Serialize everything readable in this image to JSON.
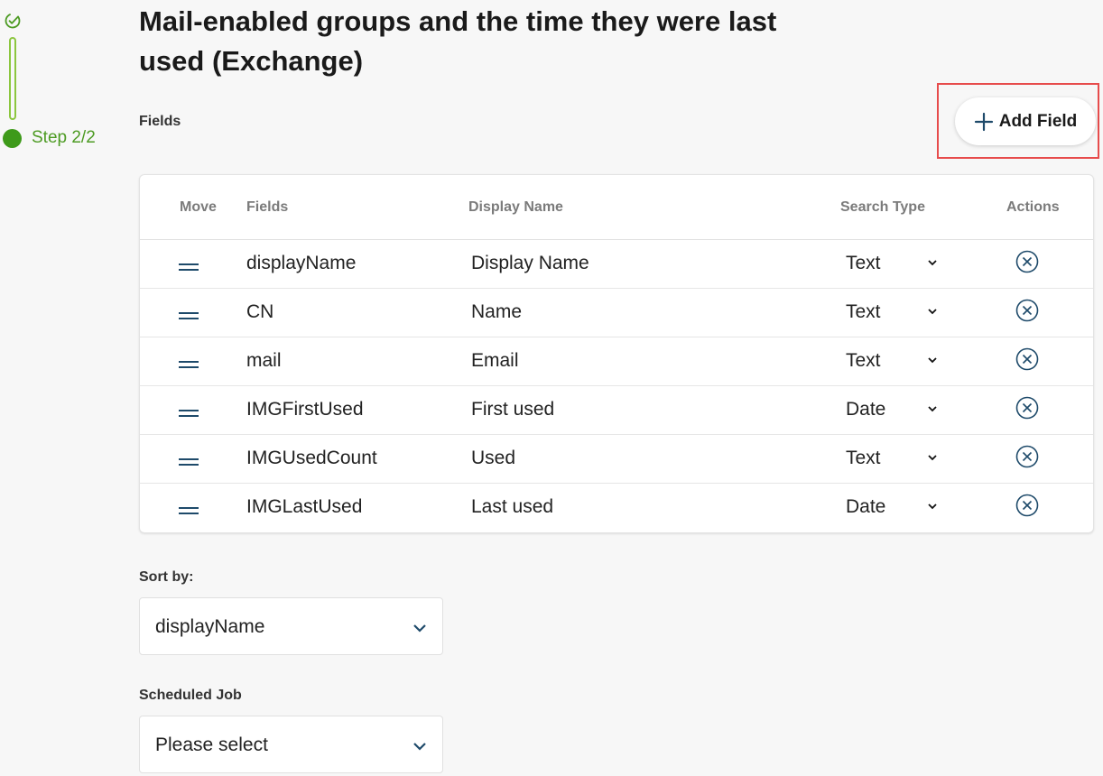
{
  "stepper": {
    "step_label": "Step 2/2",
    "done_color": "#4d9b23"
  },
  "page": {
    "title": "Mail-enabled groups and the time they were last used (Exchange)",
    "fields_label": "Fields",
    "add_field_label": "Add Field"
  },
  "table": {
    "headers": {
      "move": "Move",
      "fields": "Fields",
      "display_name": "Display Name",
      "search_type": "Search Type",
      "actions": "Actions"
    },
    "rows": [
      {
        "field": "displayName",
        "display_name": "Display Name",
        "search_type": "Text"
      },
      {
        "field": "CN",
        "display_name": "Name",
        "search_type": "Text"
      },
      {
        "field": "mail",
        "display_name": "Email",
        "search_type": "Text"
      },
      {
        "field": "IMGFirstUsed",
        "display_name": "First used",
        "search_type": "Date"
      },
      {
        "field": "IMGUsedCount",
        "display_name": "Used",
        "search_type": "Text"
      },
      {
        "field": "IMGLastUsed",
        "display_name": "Last used",
        "search_type": "Date"
      }
    ]
  },
  "sort": {
    "label": "Sort by:",
    "value": "displayName"
  },
  "scheduled_job": {
    "label": "Scheduled Job",
    "value": "Please select"
  },
  "colors": {
    "accent": "#1e4a6a",
    "highlight": "#e74c4c",
    "step_green": "#3e9a1a"
  }
}
